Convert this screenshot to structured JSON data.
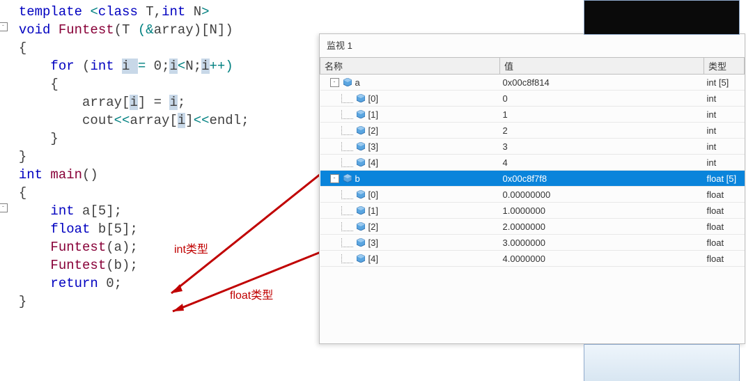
{
  "code": {
    "l1a": "template ",
    "l1b": "<",
    "l1c": "class ",
    "l1d": "T",
    "l1e": ",",
    "l1f": "int ",
    "l1g": "N",
    "l1h": ">",
    "l2a": "void ",
    "l2b": "Funtest",
    "l2c": "(",
    "l2d": "T ",
    "l2e": "(&",
    "l2f": "array",
    "l2g": ")[",
    "l2h": "N",
    "l2i": "])",
    "l3": "{",
    "l4a": "    for ",
    "l4b": "(",
    "l4c": "int ",
    "l4d": "i ",
    "l4e": "= ",
    "l4f": "0",
    "l4g": ";",
    "l4h": "i",
    "l4i": "<",
    "l4j": "N",
    "l4k": ";",
    "l4l": "i",
    "l4m": "++)",
    "l5": "    {",
    "l6a": "        array",
    "l6b": "[",
    "l6c": "i",
    "l6d": "] = ",
    "l6e": "i",
    "l6f": ";",
    "l7a": "        cout",
    "l7b": "<<",
    "l7c": "array",
    "l7d": "[",
    "l7e": "i",
    "l7f": "]",
    "l7g": "<<",
    "l7h": "endl",
    "l7i": ";",
    "l8": "    }",
    "l9": "}",
    "l10a": "int ",
    "l10b": "main",
    "l10c": "()",
    "l11": "{",
    "l12a": "    int ",
    "l12b": "a",
    "l12c": "[",
    "l12d": "5",
    "l12e": "];",
    "l13a": "    float ",
    "l13b": "b",
    "l13c": "[",
    "l13d": "5",
    "l13e": "];",
    "l14a": "    Funtest",
    "l14b": "(",
    "l14c": "a",
    "l14d": ");",
    "l15a": "    Funtest",
    "l15b": "(",
    "l15c": "b",
    "l15d": ");",
    "l16a": "    return ",
    "l16b": "0",
    "l16c": ";",
    "l17": "}"
  },
  "annotations": {
    "int_label": "int类型",
    "float_label": "float类型"
  },
  "watch": {
    "title": "监视 1",
    "headers": {
      "name": "名称",
      "value": "值",
      "type": "类型"
    },
    "rows": [
      {
        "depth": 0,
        "tw": "-",
        "icon": true,
        "name": "a",
        "value": "0x00c8f814",
        "type": "int [5]",
        "sel": false,
        "red": false
      },
      {
        "depth": 1,
        "tw": "",
        "icon": true,
        "name": "[0]",
        "value": "0",
        "type": "int",
        "sel": false,
        "red": false
      },
      {
        "depth": 1,
        "tw": "",
        "icon": true,
        "name": "[1]",
        "value": "1",
        "type": "int",
        "sel": false,
        "red": false
      },
      {
        "depth": 1,
        "tw": "",
        "icon": true,
        "name": "[2]",
        "value": "2",
        "type": "int",
        "sel": false,
        "red": false
      },
      {
        "depth": 1,
        "tw": "",
        "icon": true,
        "name": "[3]",
        "value": "3",
        "type": "int",
        "sel": false,
        "red": false
      },
      {
        "depth": 1,
        "tw": "",
        "icon": true,
        "name": "[4]",
        "value": "4",
        "type": "int",
        "sel": false,
        "red": false
      },
      {
        "depth": 0,
        "tw": "-",
        "icon": true,
        "name": "b",
        "value": "0x00c8f7f8",
        "type": "float [5]",
        "sel": true,
        "red": false
      },
      {
        "depth": 1,
        "tw": "",
        "icon": true,
        "name": "[0]",
        "value": "0.00000000",
        "type": "float",
        "sel": false,
        "red": true
      },
      {
        "depth": 1,
        "tw": "",
        "icon": true,
        "name": "[1]",
        "value": "1.0000000",
        "type": "float",
        "sel": false,
        "red": true
      },
      {
        "depth": 1,
        "tw": "",
        "icon": true,
        "name": "[2]",
        "value": "2.0000000",
        "type": "float",
        "sel": false,
        "red": true
      },
      {
        "depth": 1,
        "tw": "",
        "icon": true,
        "name": "[3]",
        "value": "3.0000000",
        "type": "float",
        "sel": false,
        "red": true
      },
      {
        "depth": 1,
        "tw": "",
        "icon": true,
        "name": "[4]",
        "value": "4.0000000",
        "type": "float",
        "sel": false,
        "red": true
      }
    ]
  }
}
